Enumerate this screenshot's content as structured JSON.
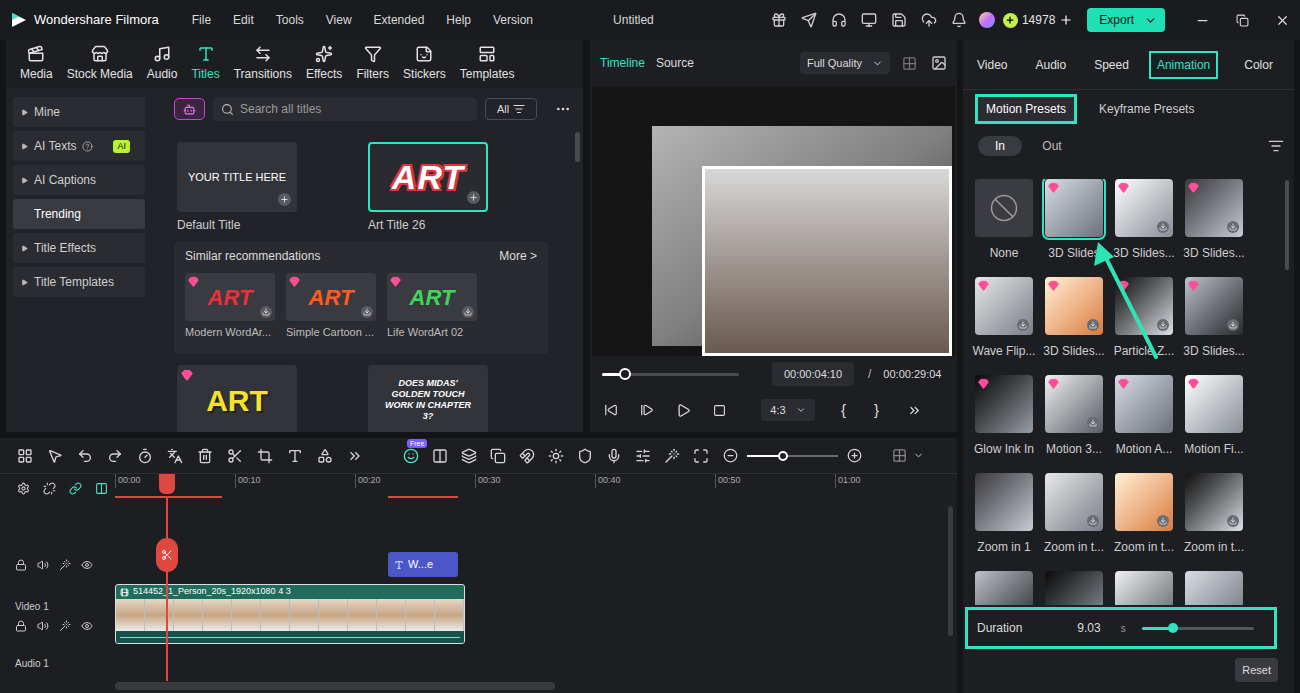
{
  "app": {
    "name": "Wondershare Filmora",
    "document": "Untitled"
  },
  "menu": [
    "File",
    "Edit",
    "Tools",
    "View",
    "Extended",
    "Help",
    "Version"
  ],
  "account": {
    "credits": "14978"
  },
  "export": {
    "label": "Export"
  },
  "library": {
    "tabs": [
      {
        "label": "Media",
        "selected": false
      },
      {
        "label": "Stock Media",
        "selected": false
      },
      {
        "label": "Audio",
        "selected": false
      },
      {
        "label": "Titles",
        "selected": true
      },
      {
        "label": "Transitions",
        "selected": false
      },
      {
        "label": "Effects",
        "selected": false
      },
      {
        "label": "Filters",
        "selected": false
      },
      {
        "label": "Stickers",
        "selected": false
      },
      {
        "label": "Templates",
        "selected": false
      }
    ],
    "sidebar": [
      {
        "label": "Mine",
        "expandable": true,
        "selected": false
      },
      {
        "label": "AI Texts",
        "expandable": true,
        "selected": false,
        "badge": "AI"
      },
      {
        "label": "AI Captions",
        "expandable": true,
        "selected": false
      },
      {
        "label": "Trending",
        "expandable": false,
        "selected": true
      },
      {
        "label": "Title Effects",
        "expandable": true,
        "selected": false
      },
      {
        "label": "Title Templates",
        "expandable": true,
        "selected": false
      }
    ],
    "search": {
      "placeholder": "Search all titles",
      "filter": "All"
    },
    "titles": [
      {
        "name": "Default Title",
        "thumb_text": "YOUR TITLE HERE",
        "selected": false,
        "kind": "plain"
      },
      {
        "name": "Art Title 26",
        "thumb_text": "ART",
        "selected": true,
        "kind": "art"
      }
    ],
    "recommendations": {
      "heading": "Similar recommendations",
      "more": "More >",
      "items": [
        {
          "name": "Modern WordAr...",
          "thumb_text": "ART",
          "color": "#e8313a"
        },
        {
          "name": "Simple Cartoon ...",
          "thumb_text": "ART",
          "color": "#ff5a1f"
        },
        {
          "name": "Life WordArt 02",
          "thumb_text": "ART",
          "color": "#3fd65a"
        }
      ]
    },
    "more_titles": [
      {
        "thumb_text": "ART",
        "color": "#f6e12b",
        "premium": true
      },
      {
        "thumb_text": "DOES MIDAS' GOLDEN TOUCH WORK IN CHAPTER 3?",
        "color": "#ffffff",
        "premium": false
      }
    ]
  },
  "preview": {
    "tabs": [
      {
        "label": "Timeline",
        "selected": true
      },
      {
        "label": "Source",
        "selected": false
      }
    ],
    "quality": "Full Quality",
    "progress": 0.17,
    "current": "00:00:04:10",
    "separator": "/",
    "total": "00:00:29:04",
    "ratio": "4:3",
    "mark_in": "{",
    "mark_out": "}"
  },
  "properties": {
    "tabs": [
      {
        "label": "Video",
        "selected": false
      },
      {
        "label": "Audio",
        "selected": false
      },
      {
        "label": "Speed",
        "selected": false
      },
      {
        "label": "Animation",
        "selected": true
      },
      {
        "label": "Color",
        "selected": false
      }
    ],
    "subtabs": [
      {
        "label": "Motion Presets",
        "selected": true
      },
      {
        "label": "Keyframe Presets",
        "selected": false
      }
    ],
    "direction": [
      {
        "label": "In",
        "selected": true
      },
      {
        "label": "Out",
        "selected": false
      }
    ],
    "presets": [
      {
        "label": "None",
        "kind": "none",
        "selected": false,
        "premium": false,
        "download": false
      },
      {
        "label": "3D Slides",
        "kind": "preset",
        "selected": true,
        "premium": true,
        "download": false
      },
      {
        "label": "3D Slides...",
        "kind": "preset",
        "selected": false,
        "premium": true,
        "download": true
      },
      {
        "label": "3D Slides...",
        "kind": "preset",
        "selected": false,
        "premium": true,
        "download": true
      },
      {
        "label": "Wave Flip...",
        "kind": "preset",
        "selected": false,
        "premium": true,
        "download": true
      },
      {
        "label": "3D Slides...",
        "kind": "preset",
        "selected": false,
        "premium": true,
        "download": true
      },
      {
        "label": "Particle Z...",
        "kind": "preset",
        "selected": false,
        "premium": true,
        "download": true
      },
      {
        "label": "3D Slides...",
        "kind": "preset",
        "selected": false,
        "premium": true,
        "download": true
      },
      {
        "label": "Glow Ink In",
        "kind": "preset",
        "selected": false,
        "premium": true,
        "download": false
      },
      {
        "label": "Motion 3...",
        "kind": "preset",
        "selected": false,
        "premium": true,
        "download": true
      },
      {
        "label": "Motion A...",
        "kind": "preset",
        "selected": false,
        "premium": true,
        "download": false
      },
      {
        "label": "Motion Fi...",
        "kind": "preset",
        "selected": false,
        "premium": true,
        "download": false
      },
      {
        "label": "Zoom in 1",
        "kind": "preset",
        "selected": false,
        "premium": false,
        "download": false
      },
      {
        "label": "Zoom in t...",
        "kind": "preset",
        "selected": false,
        "premium": false,
        "download": true
      },
      {
        "label": "Zoom in t...",
        "kind": "preset",
        "selected": false,
        "premium": false,
        "download": true
      },
      {
        "label": "Zoom in t...",
        "kind": "preset",
        "selected": false,
        "premium": false,
        "download": true
      },
      {
        "kind": "preset",
        "selected": false,
        "premium": false,
        "download": false
      },
      {
        "kind": "preset",
        "selected": false,
        "premium": false,
        "download": false
      },
      {
        "kind": "preset",
        "selected": false,
        "premium": false,
        "download": false
      },
      {
        "kind": "preset",
        "selected": false,
        "premium": false,
        "download": false
      }
    ],
    "duration": {
      "label": "Duration",
      "value": "9.03",
      "unit": "s",
      "level": 0.28
    },
    "reset": "Reset"
  },
  "timeline": {
    "free_badge": "Free",
    "zoom": 0.4,
    "ruler": [
      "00:00",
      "00:10",
      "00:20",
      "00:30",
      "00:40",
      "00:50",
      "01:00"
    ],
    "title_clip": "W...e",
    "video_clip": "514452_1_Person_20s_1920x1080 4 3",
    "tracks": [
      "Video 1",
      "Audio 1"
    ]
  }
}
